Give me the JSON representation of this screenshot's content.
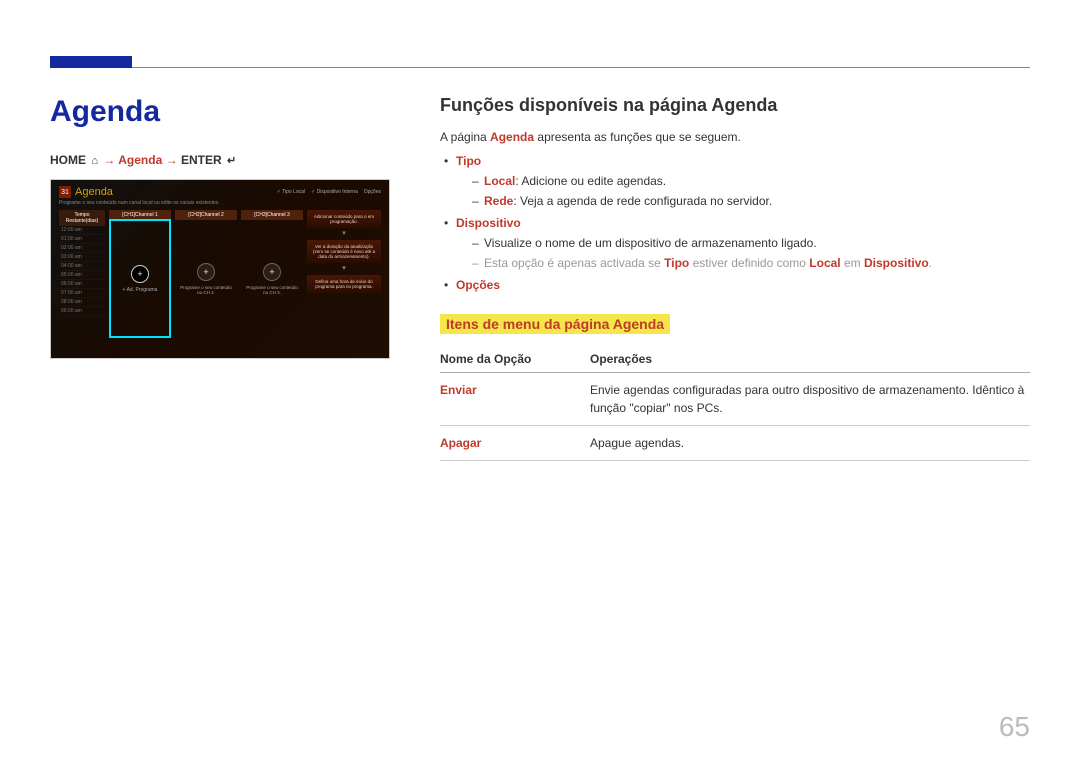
{
  "page_number": "65",
  "left": {
    "title": "Agenda",
    "breadcrumb": {
      "home": "HOME",
      "arrow": " → ",
      "mid": "Agenda",
      "enter": "ENTER"
    },
    "shot": {
      "cal_day": "31",
      "title": "Agenda",
      "menu": {
        "a_pre": "Tipo",
        "a_val": "Local",
        "b_pre": "Dispositivo",
        "b_val": "Interna",
        "c": "Opções"
      },
      "sub": "Programe o seu conteúdo num canal local ou edite os canais existentes.",
      "times_header": "Tempo Restante(dias)",
      "times": [
        "12:00 am",
        "01:00 am",
        "02:00 am",
        "03:00 am",
        "04:00 am",
        "05:00 am",
        "06:00 am",
        "07:00 am",
        "08:00 am",
        "09:00 am"
      ],
      "ch1": {
        "h": "[CH1]Channel 1",
        "btn": "+ Ad. Programa"
      },
      "ch2": {
        "h": "[CH2]Channel 2",
        "cap": "Programe o seu conteúdo no CH 2."
      },
      "ch3": {
        "h": "[CH3]Channel 3",
        "cap": "Programe o seu conteúdo no CH 3."
      },
      "cards": {
        "a": "Adicionar conteúdo para o em programação.",
        "b": "Ver a duração da atualização (zero se conteúdo é novo até a data do armazenamento).",
        "c": "Defina uma hora de inicio do programa para no programa."
      }
    }
  },
  "right": {
    "h2": "Funções disponíveis na página Agenda",
    "intro_pre": "A página ",
    "intro_strong": "Agenda",
    "intro_post": " apresenta as funções que se seguem.",
    "tipo": {
      "k": "Tipo",
      "local_k": "Local",
      "local_v": ": Adicione ou edite agendas.",
      "rede_k": "Rede",
      "rede_v": ": Veja a agenda de rede configurada no servidor."
    },
    "dispositivo": {
      "k": "Dispositivo",
      "line": "Visualize o nome de um dispositivo de armazenamento ligado.",
      "note_pre": "Esta opção é apenas activada se ",
      "note_tipo": "Tipo",
      "note_mid": " estiver definido como ",
      "note_local": "Local",
      "note_em": " em ",
      "note_disp": "Dispositivo",
      "note_end": "."
    },
    "opcoes": {
      "k": "Opções"
    },
    "h3": "Itens de menu da página Agenda",
    "table": {
      "col1": "Nome da Opção",
      "col2": "Operações",
      "rows": [
        {
          "name": "Enviar",
          "desc": "Envie agendas configuradas para outro dispositivo de armazenamento. Idêntico à função \"copiar\" nos PCs."
        },
        {
          "name": "Apagar",
          "desc": "Apague agendas."
        }
      ]
    }
  }
}
